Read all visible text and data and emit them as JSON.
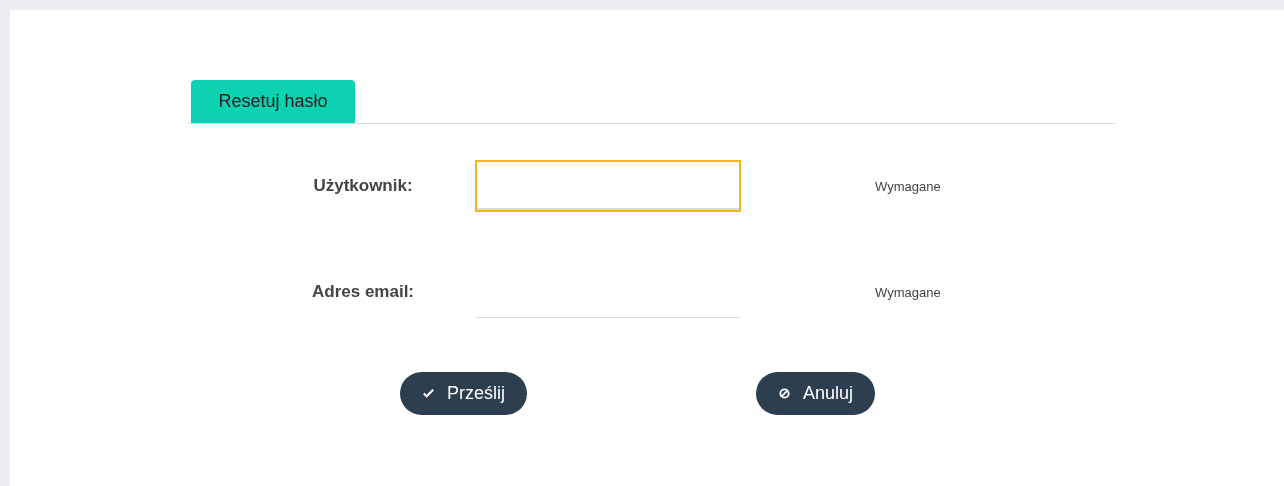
{
  "tabs": [
    {
      "label": "Resetuj hasło",
      "selected": true
    }
  ],
  "fields": [
    {
      "label": "Użytkownik:",
      "hint": "Wymagane",
      "focused": true
    },
    {
      "label": "Adres email:",
      "hint": "Wymagane",
      "focused": false
    }
  ],
  "buttons": [
    {
      "label": "Prześlij",
      "kind": "submit"
    },
    {
      "label": "Anuluj",
      "kind": "cancel"
    }
  ]
}
